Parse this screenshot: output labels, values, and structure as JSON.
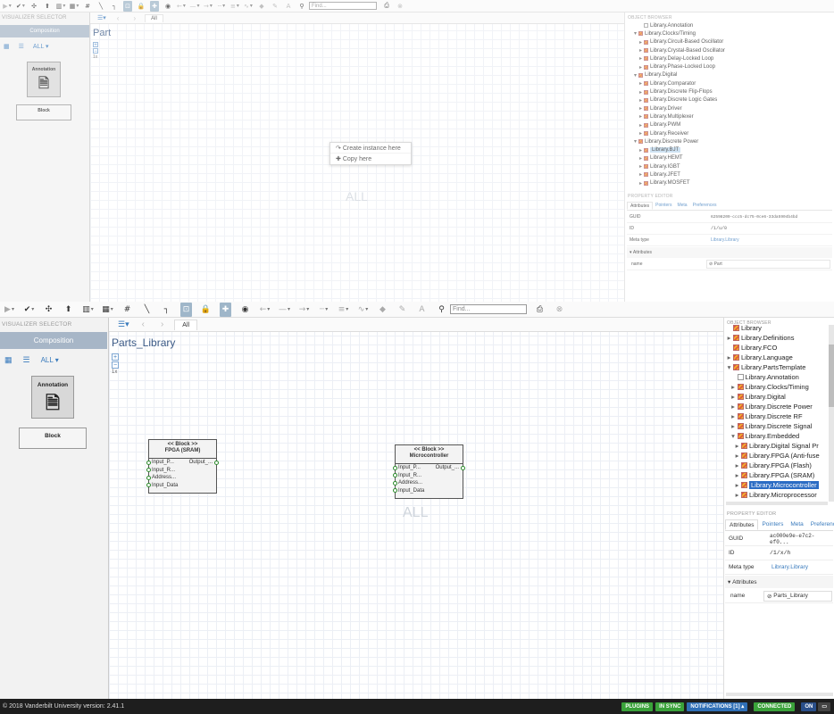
{
  "toolbar": {
    "find_placeholder": "Find..."
  },
  "top": {
    "visualizer_selector_title": "VISUALIZER SELECTOR",
    "composition_label": "Composition",
    "all_label": "ALL",
    "annotation_label": "Annotation",
    "block_label": "Block",
    "tab_all": "All",
    "canvas_title": "Part",
    "zoom_label": "1x",
    "watermark": "ALL",
    "context_menu": {
      "create_instance": "Create instance here",
      "copy_here": "Copy here"
    },
    "object_browser": {
      "title": "OBJECT BROWSER",
      "items": [
        {
          "label": "Library.Annotation",
          "level": 2,
          "toggle": "",
          "icon": "plain"
        },
        {
          "label": "Library.Clocks/Timing",
          "level": 1,
          "toggle": "▾",
          "icon": "lib"
        },
        {
          "label": "Library.Circuit-Based Oscillator",
          "level": 2,
          "toggle": "▸",
          "icon": "lib"
        },
        {
          "label": "Library.Crystal-Based Oscillator",
          "level": 2,
          "toggle": "▸",
          "icon": "lib"
        },
        {
          "label": "Library.Delay-Locked Loop",
          "level": 2,
          "toggle": "▸",
          "icon": "lib"
        },
        {
          "label": "Library.Phase-Locked Loop",
          "level": 2,
          "toggle": "▸",
          "icon": "lib"
        },
        {
          "label": "Library.Digital",
          "level": 1,
          "toggle": "▾",
          "icon": "lib"
        },
        {
          "label": "Library.Comparator",
          "level": 2,
          "toggle": "▸",
          "icon": "lib"
        },
        {
          "label": "Library.Discrete Flip-Flops",
          "level": 2,
          "toggle": "▸",
          "icon": "lib"
        },
        {
          "label": "Library.Discrete Logic Gates",
          "level": 2,
          "toggle": "▸",
          "icon": "lib"
        },
        {
          "label": "Library.Driver",
          "level": 2,
          "toggle": "▸",
          "icon": "lib"
        },
        {
          "label": "Library.Multiplexer",
          "level": 2,
          "toggle": "▸",
          "icon": "lib"
        },
        {
          "label": "Library.PWM",
          "level": 2,
          "toggle": "▸",
          "icon": "lib"
        },
        {
          "label": "Library.Receiver",
          "level": 2,
          "toggle": "▸",
          "icon": "lib"
        },
        {
          "label": "Library.Discrete Power",
          "level": 1,
          "toggle": "▾",
          "icon": "lib"
        },
        {
          "label": "Library.BJT",
          "level": 2,
          "toggle": "▸",
          "icon": "lib",
          "selected": "light"
        },
        {
          "label": "Library.HEMT",
          "level": 2,
          "toggle": "▸",
          "icon": "lib"
        },
        {
          "label": "Library.IGBT",
          "level": 2,
          "toggle": "▸",
          "icon": "lib"
        },
        {
          "label": "Library.JFET",
          "level": 2,
          "toggle": "▸",
          "icon": "lib"
        },
        {
          "label": "Library.MOSFET",
          "level": 2,
          "toggle": "▸",
          "icon": "lib"
        }
      ]
    },
    "property_editor": {
      "title": "PROPERTY EDITOR",
      "tabs": [
        "Attributes",
        "Pointers",
        "Meta",
        "Preferences"
      ],
      "guid_label": "GUID",
      "guid_value": "62598209-ccc5-dc75-0ce6-33da5904b4bd",
      "id_label": "ID",
      "id_value": "/1/u/0",
      "meta_type_label": "Meta type",
      "meta_type_value": "Library.Library",
      "attributes_header": "Attributes",
      "name_label": "name",
      "name_value": "Part"
    }
  },
  "bottom": {
    "visualizer_selector_title": "VISUALIZER SELECTOR",
    "composition_label": "Composition",
    "all_label": "ALL",
    "annotation_label": "Annotation",
    "block_label": "Block",
    "tab_all": "All",
    "canvas_title": "Parts_Library",
    "zoom_label": "1x",
    "watermark": "ALL",
    "nodes": [
      {
        "stereotype": "<< Block >>",
        "name": "FPGA (SRAM)",
        "ports": [
          "Input_P...",
          "Input_R...",
          "Address...",
          "Input_Data"
        ],
        "output": "Output_..."
      },
      {
        "stereotype": "<< Block >>",
        "name": "Microcontroller",
        "ports": [
          "Input_P...",
          "Input_R...",
          "Address...",
          "Input_Data"
        ],
        "output": "Output_..."
      }
    ],
    "object_browser": {
      "title": "OBJECT BROWSER",
      "items": [
        {
          "label": "Library",
          "level": 0,
          "toggle": "",
          "icon": "lib"
        },
        {
          "label": "Library.Definitions",
          "level": 0,
          "toggle": "▸",
          "icon": "lib"
        },
        {
          "label": "Library.FCO",
          "level": 0,
          "toggle": "",
          "icon": "lib"
        },
        {
          "label": "Library.Language",
          "level": 0,
          "toggle": "▸",
          "icon": "lib"
        },
        {
          "label": "Library.PartsTemplate",
          "level": 0,
          "toggle": "▾",
          "icon": "lib"
        },
        {
          "label": "Library.Annotation",
          "level": 1,
          "toggle": "",
          "icon": "plain"
        },
        {
          "label": "Library.Clocks/Timing",
          "level": 1,
          "toggle": "▸",
          "icon": "lib"
        },
        {
          "label": "Library.Digital",
          "level": 1,
          "toggle": "▸",
          "icon": "lib"
        },
        {
          "label": "Library.Discrete Power",
          "level": 1,
          "toggle": "▸",
          "icon": "lib"
        },
        {
          "label": "Library.Discrete RF",
          "level": 1,
          "toggle": "▸",
          "icon": "lib"
        },
        {
          "label": "Library.Discrete Signal",
          "level": 1,
          "toggle": "▸",
          "icon": "lib"
        },
        {
          "label": "Library.Embedded",
          "level": 1,
          "toggle": "▾",
          "icon": "lib"
        },
        {
          "label": "Library.Digital Signal Pr",
          "level": 2,
          "toggle": "▸",
          "icon": "lib"
        },
        {
          "label": "Library.FPGA (Anti-fuse",
          "level": 2,
          "toggle": "▸",
          "icon": "lib"
        },
        {
          "label": "Library.FPGA (Flash)",
          "level": 2,
          "toggle": "▸",
          "icon": "lib"
        },
        {
          "label": "Library.FPGA (SRAM)",
          "level": 2,
          "toggle": "▸",
          "icon": "lib"
        },
        {
          "label": "Library.Microcontroller",
          "level": 2,
          "toggle": "▸",
          "icon": "lib",
          "selected": "dark"
        },
        {
          "label": "Library.Microprocessor",
          "level": 2,
          "toggle": "▸",
          "icon": "lib"
        }
      ]
    },
    "property_editor": {
      "title": "PROPERTY EDITOR",
      "tabs": [
        "Attributes",
        "Pointers",
        "Meta",
        "Preferences"
      ],
      "guid_label": "GUID",
      "guid_value": "ac000e9e-e7c2-ef0...",
      "id_label": "ID",
      "id_value": "/1/x/h",
      "meta_type_label": "Meta type",
      "meta_type_value": "Library.Library",
      "attributes_header": "Attributes",
      "name_label": "name",
      "name_value": "Parts_Library"
    }
  },
  "footer": {
    "copyright": "© 2018 Vanderbilt University version: 2.41.1",
    "plugins": "PLUGINS",
    "in_sync": "IN SYNC",
    "notifications": "NOTIFICATIONS [1]",
    "connected": "CONNECTED",
    "on": "ON"
  },
  "icons": {
    "play": "play-icon",
    "check": "check-circle-icon",
    "upload": "upload-icon",
    "layout": "layout-icon",
    "grid": "grid-icon",
    "hash": "hash-icon",
    "connection": "connection-icon",
    "elbow": "elbow-connection-icon",
    "lock": "lock-icon",
    "move": "move-icon",
    "eye": "eye-icon",
    "arrow-left": "arrow-left-icon",
    "line": "line-style-icon",
    "arrow-right": "arrow-right-icon",
    "fill": "fill-color-icon",
    "pen": "pen-color-icon",
    "text": "text-color-icon",
    "search": "search-icon",
    "print": "print-icon",
    "close": "close-circle-icon"
  }
}
